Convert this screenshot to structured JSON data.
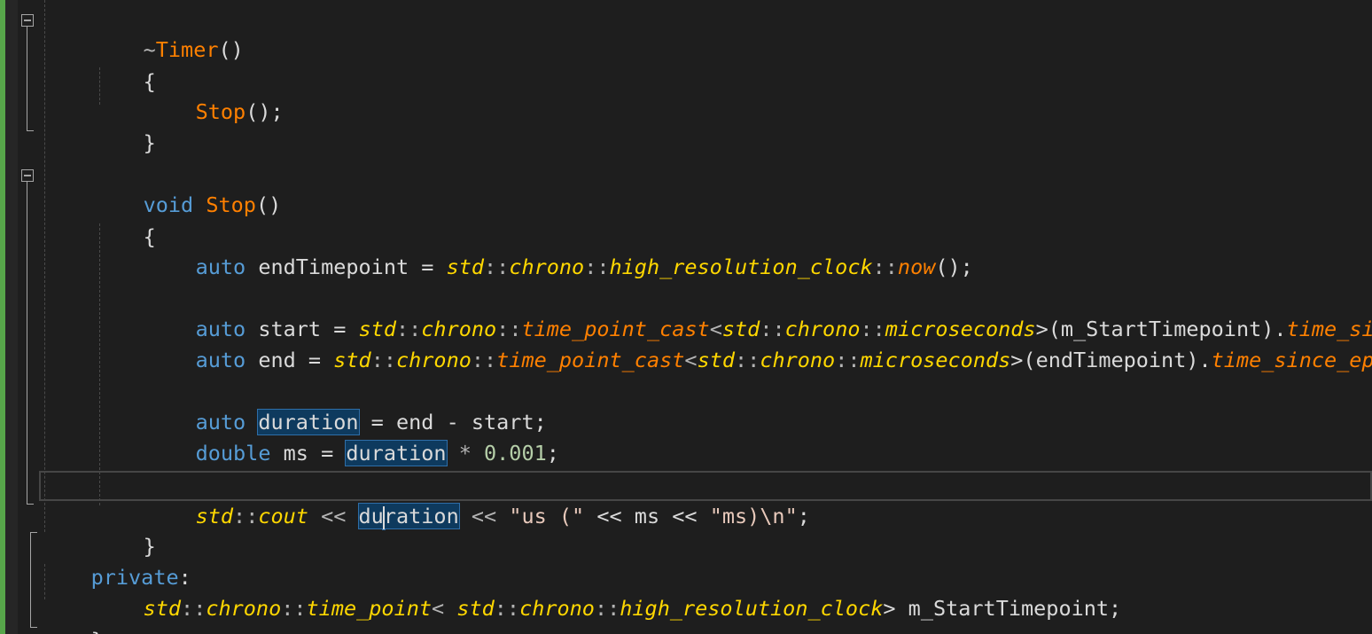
{
  "editor": {
    "highlighted_symbol": "duration",
    "lines": {
      "l1": [
        "~",
        "Timer",
        "()"
      ],
      "l2": [
        "{"
      ],
      "l3": [
        "Stop",
        "();"
      ],
      "l4": [
        "}"
      ],
      "l5": [
        "void",
        " ",
        "Stop",
        "()"
      ],
      "l6": [
        "{"
      ],
      "l7": [
        "auto",
        " endTimepoint = ",
        "std",
        "::",
        "chrono",
        "::",
        "high_resolution_clock",
        "::",
        "now",
        "();"
      ],
      "l8": [
        "auto",
        " start = ",
        "std",
        "::",
        "chrono",
        "::",
        "time_point_cast",
        "<",
        "std",
        "::",
        "chrono",
        "::",
        "microseconds",
        ">(m_StartTimepoint).",
        "time_si"
      ],
      "l9": [
        "auto",
        " end = ",
        "std",
        "::",
        "chrono",
        "::",
        "time_point_cast",
        "<",
        "std",
        "::",
        "chrono",
        "::",
        "microseconds",
        ">(endTimepoint).",
        "time_since_ep"
      ],
      "l10": [
        "auto",
        " ",
        "duration",
        " = end - start;"
      ],
      "l11": [
        "double",
        " ms = ",
        "duration",
        " * ",
        "0.001",
        ";"
      ],
      "l12": [
        "std",
        "::",
        "cout",
        " << ",
        "du",
        "ration",
        " << ",
        "\"us (\"",
        " << ms << ",
        "\"ms)\\n\"",
        ";"
      ],
      "l13": [
        "}"
      ],
      "l14": [
        "private",
        ":"
      ],
      "l15": [
        "std",
        "::",
        "chrono",
        "::",
        "time_point",
        "< ",
        "std",
        "::",
        "chrono",
        "::",
        "high_resolution_clock",
        "> m_StartTimepoint;"
      ],
      "l16": [
        "};"
      ]
    }
  },
  "colors": {
    "background": "#1e1e1e",
    "keyword": "#569cd6",
    "function": "#ff8000",
    "type": "#ffd700",
    "identifier": "#dadada",
    "string": "#e8c9bb",
    "number": "#b5cea8",
    "change_bar": "#57a64a",
    "reference_highlight": "#0e3a5e"
  }
}
